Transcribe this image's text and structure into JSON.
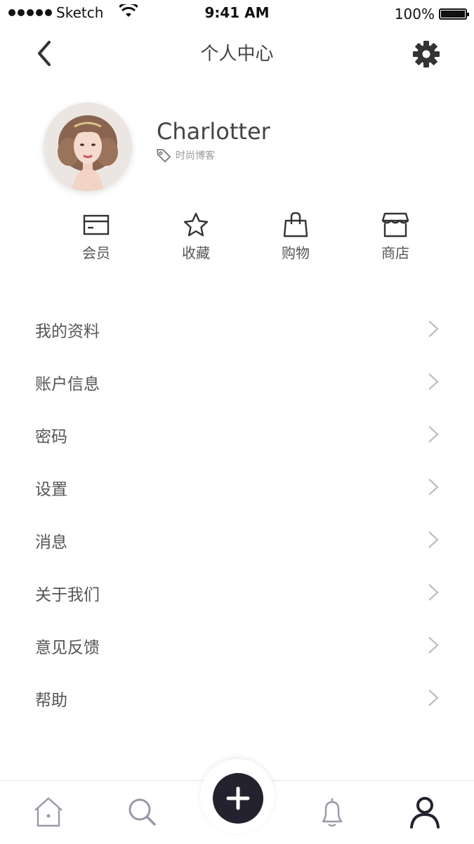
{
  "status_bar": {
    "carrier": "Sketch",
    "time": "9:41 AM",
    "battery": "100%"
  },
  "nav": {
    "title": "个人中心",
    "back_icon": "chevron-left-icon",
    "settings_icon": "gear-icon"
  },
  "profile": {
    "name": "Charlotter",
    "tag": "时尚博客",
    "tag_icon": "tag-icon"
  },
  "quick_actions": [
    {
      "label": "会员",
      "icon": "card-icon"
    },
    {
      "label": "收藏",
      "icon": "star-icon"
    },
    {
      "label": "购物",
      "icon": "shopping-bag-icon"
    },
    {
      "label": "商店",
      "icon": "store-icon"
    }
  ],
  "menu": [
    {
      "label": "我的资料"
    },
    {
      "label": "账户信息"
    },
    {
      "label": "密码"
    },
    {
      "label": "设置"
    },
    {
      "label": "消息"
    },
    {
      "label": "关于我们"
    },
    {
      "label": "意见反馈"
    },
    {
      "label": "帮助"
    }
  ],
  "tab_bar": {
    "tabs": [
      "home-icon",
      "search-icon",
      "plus-icon",
      "bell-icon",
      "user-icon"
    ],
    "active": "user-icon"
  },
  "colors": {
    "accent_dark": "#24222e",
    "text": "#555555",
    "muted": "#999999",
    "inactive_icon": "#9a98a8"
  }
}
